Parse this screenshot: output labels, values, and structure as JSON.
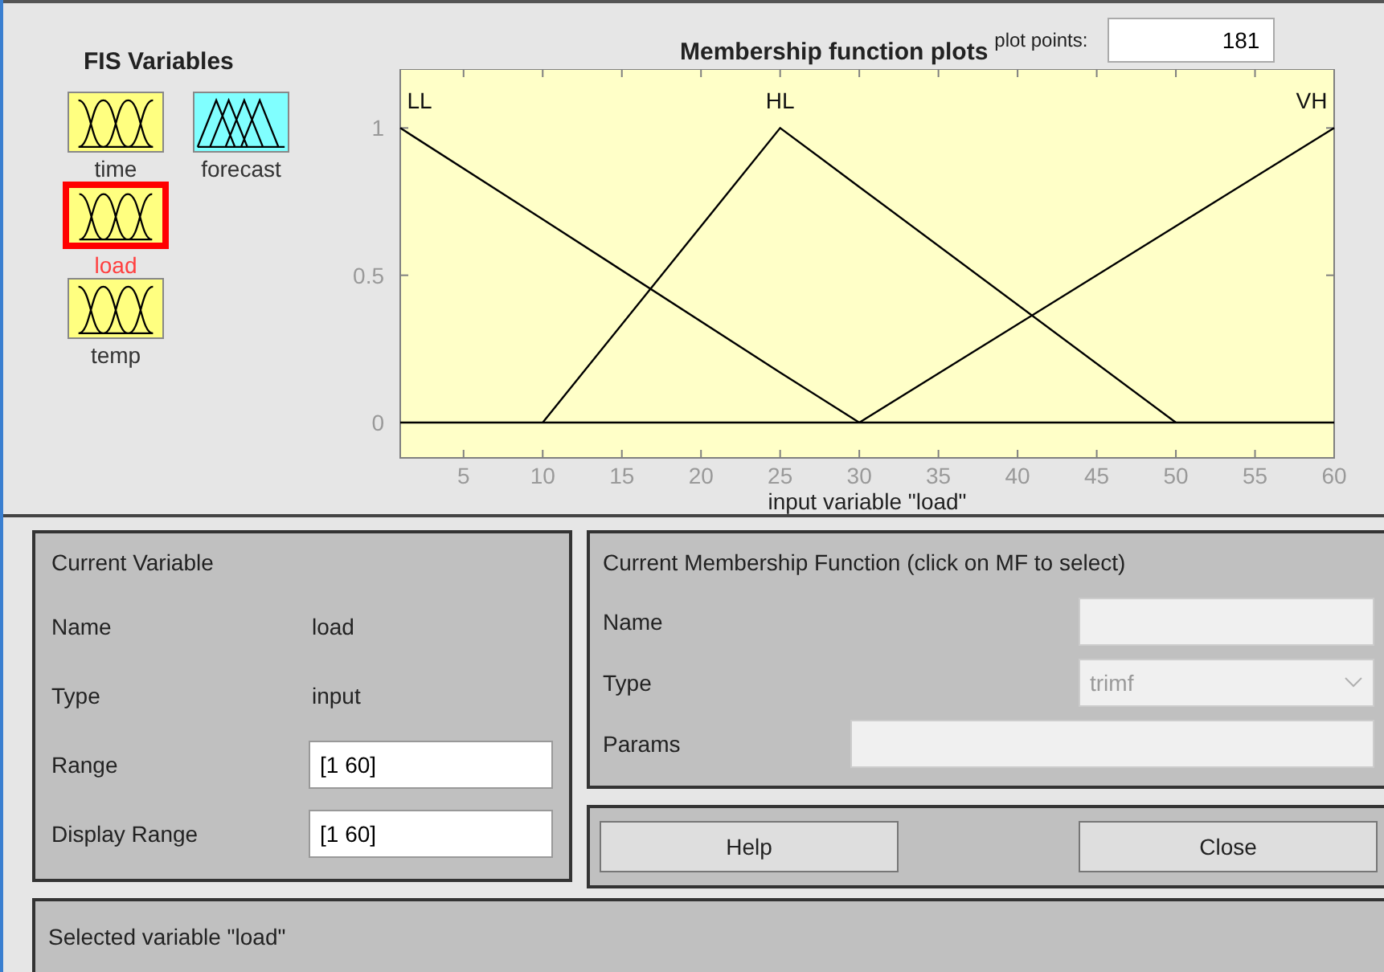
{
  "fis_variables": {
    "title": "FIS Variables",
    "items": [
      {
        "name": "time",
        "kind": "input",
        "selected": false
      },
      {
        "name": "forecast",
        "kind": "output",
        "selected": false
      },
      {
        "name": "load",
        "kind": "input",
        "selected": true
      },
      {
        "name": "temp",
        "kind": "input",
        "selected": false
      }
    ]
  },
  "plot": {
    "title": "Membership function plots",
    "plot_points_label": "plot points:",
    "plot_points": "181",
    "chart_data": {
      "type": "line",
      "xlabel": "input variable \"load\"",
      "x": [
        1,
        10,
        25,
        30,
        50,
        60
      ],
      "xlim": [
        1,
        60
      ],
      "ylim": [
        -0.12,
        1.2
      ],
      "xticks": [
        5,
        10,
        15,
        20,
        25,
        30,
        35,
        40,
        45,
        50,
        55,
        60
      ],
      "yticks": [
        0,
        0.5,
        1
      ],
      "series": [
        {
          "name": "LL",
          "color": "#000000",
          "values": [
            1,
            0.69,
            0.17,
            0,
            null,
            null
          ]
        },
        {
          "name": "HL",
          "color": "#000000",
          "values": [
            null,
            0,
            1,
            0.8,
            0,
            null
          ]
        },
        {
          "name": "VH",
          "color": "#000000",
          "values": [
            null,
            null,
            null,
            0,
            0.667,
            1
          ]
        }
      ]
    }
  },
  "current_variable": {
    "title": "Current Variable",
    "rows": [
      {
        "label": "Name",
        "value": "load",
        "kind": "text"
      },
      {
        "label": "Type",
        "value": "input",
        "kind": "text"
      },
      {
        "label": "Range",
        "value": "[1 60]",
        "kind": "field"
      },
      {
        "label": "Display Range",
        "value": "[1 60]",
        "kind": "field"
      }
    ]
  },
  "current_mf": {
    "title": "Current Membership Function (click on MF to select)",
    "name_label": "Name",
    "type_label": "Type",
    "type_value": "trimf",
    "type_disabled": true,
    "params_label": "Params"
  },
  "buttons": [
    "Help",
    "Close"
  ],
  "status": "Selected variable \"load\""
}
